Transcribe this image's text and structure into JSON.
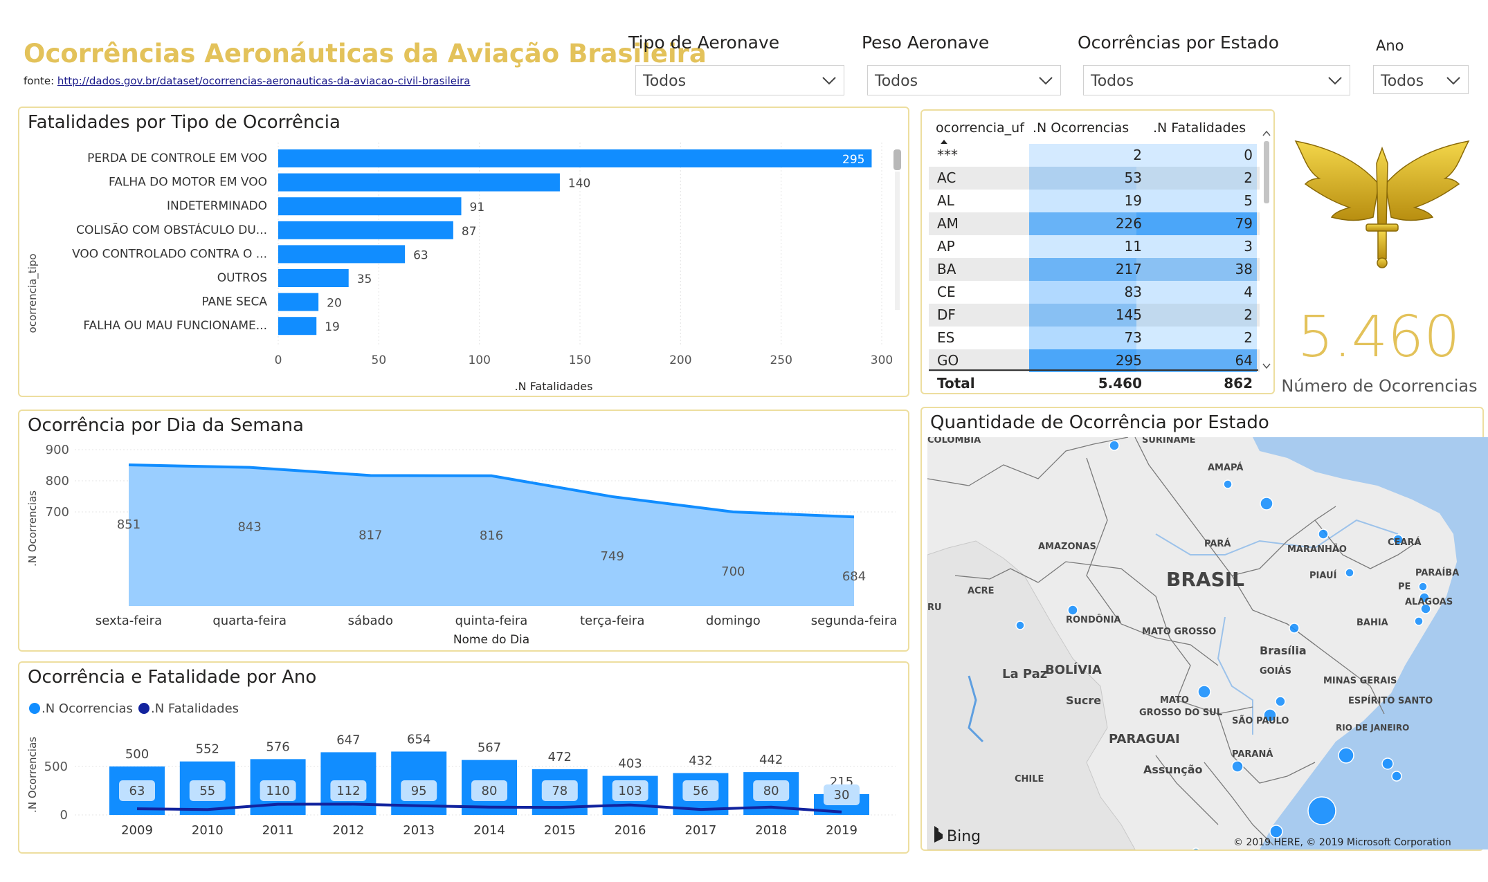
{
  "header": {
    "title": "Ocorrências Aeronáuticas da Aviação Brasileira",
    "source_prefix": "fonte: ",
    "source_link": "http://dados.gov.br/dataset/ocorrencias-aeronauticas-da-aviacao-civil-brasileira"
  },
  "filters": [
    {
      "label": "Tipo de Aeronave",
      "value": "Todos"
    },
    {
      "label": "Peso Aeronave",
      "value": "Todos"
    },
    {
      "label": "Ocorrências por Estado",
      "value": "Todos"
    },
    {
      "label": "Ano",
      "value": "Todos"
    }
  ],
  "colors": {
    "accent_gold": "#E3C25A",
    "bar_blue": "#118DFF",
    "area_blue": "#9ACEFF",
    "line_navy": "#12239E",
    "panel_border": "#EDDE9F"
  },
  "fatalities_panel": {
    "title": "Fatalidades por Tipo de Ocorrência"
  },
  "weekday_panel": {
    "title": "Ocorrência por Dia da Semana"
  },
  "year_panel": {
    "title": "Ocorrência e Fatalidade por Ano"
  },
  "state_table": {
    "headers": [
      "ocorrencia_uf",
      ".N Ocorrencias",
      ".N Fatalidades"
    ],
    "rows": [
      {
        "uf": "***",
        "ocorrencias": "2",
        "fatalidades": "0"
      },
      {
        "uf": "AC",
        "ocorrencias": "53",
        "fatalidades": "2"
      },
      {
        "uf": "AL",
        "ocorrencias": "19",
        "fatalidades": "5"
      },
      {
        "uf": "AM",
        "ocorrencias": "226",
        "fatalidades": "79"
      },
      {
        "uf": "AP",
        "ocorrencias": "11",
        "fatalidades": "3"
      },
      {
        "uf": "BA",
        "ocorrencias": "217",
        "fatalidades": "38"
      },
      {
        "uf": "CE",
        "ocorrencias": "83",
        "fatalidades": "4"
      },
      {
        "uf": "DF",
        "ocorrencias": "145",
        "fatalidades": "2"
      },
      {
        "uf": "ES",
        "ocorrencias": "73",
        "fatalidades": "2"
      },
      {
        "uf": "GO",
        "ocorrencias": "295",
        "fatalidades": "64"
      }
    ],
    "total": {
      "label": "Total",
      "ocorrencias": "5.460",
      "fatalidades": "862"
    }
  },
  "kpi": {
    "value": "5.460",
    "label": "Número de Ocorrencias"
  },
  "map_panel": {
    "title": "Quantidade de Ocorrência por Estado",
    "labels": [
      "COLOMBIA",
      "SURINAME",
      "AMAPÁ",
      "AMAZONAS",
      "PARÁ",
      "MARANHÃO",
      "CEARÁ",
      "PARAÍBA",
      "PE",
      "ALAGOAS",
      "PIAUÍ",
      "BRASIL",
      "ACRE",
      "RU",
      "RONDÔNIA",
      "MATO GROSSO",
      "BAHIA",
      "Brasília",
      "GOIÁS",
      "MINAS GERAIS",
      "La Paz",
      "BOLÍVIA",
      "Sucre",
      "MATO GROSSO DO SUL",
      "SÃO PAULO",
      "ESPÍRITO SANTO",
      "RIO DE JANEIRO",
      "PARAGUAI",
      "PARANÁ",
      "Assunção",
      "CHILE"
    ],
    "bing_label": "Bing",
    "copyright": "© 2019 HERE, © 2019 Microsoft Corporation"
  },
  "chart_data": [
    {
      "type": "bar",
      "orientation": "horizontal",
      "title": "Fatalidades por Tipo de Ocorrência",
      "ylabel": "ocorrencia_tipo",
      "xlabel": ".N Fatalidades",
      "categories": [
        "PERDA DE CONTROLE EM VOO",
        "FALHA DO MOTOR EM VOO",
        "INDETERMINADO",
        "COLISÃO COM OBSTÁCULO DU...",
        "VOO CONTROLADO CONTRA O ...",
        "OUTROS",
        "PANE SECA",
        "FALHA OU MAU FUNCIONAME..."
      ],
      "values": [
        295,
        140,
        91,
        87,
        63,
        35,
        20,
        19
      ],
      "xlim": [
        0,
        300
      ],
      "xticks": [
        0,
        50,
        100,
        150,
        200,
        250,
        300
      ]
    },
    {
      "type": "area",
      "title": "Ocorrência por Dia da Semana",
      "xlabel": "Nome do Dia",
      "ylabel": ".N Ocorrencias",
      "categories": [
        "sexta-feira",
        "quarta-feira",
        "sábado",
        "quinta-feira",
        "terça-feira",
        "domingo",
        "segunda-feira"
      ],
      "values": [
        851,
        843,
        817,
        816,
        749,
        700,
        684
      ],
      "ylim": [
        650,
        900
      ],
      "yticks": [
        700,
        800,
        900
      ]
    },
    {
      "type": "bar",
      "title": "Ocorrência e Fatalidade por Ano",
      "ylabel": ".N Ocorrencias",
      "categories": [
        "2009",
        "2010",
        "2011",
        "2012",
        "2013",
        "2014",
        "2015",
        "2016",
        "2017",
        "2018",
        "2019"
      ],
      "series": [
        {
          "name": ".N Ocorrencias",
          "kind": "bar",
          "values": [
            500,
            552,
            576,
            647,
            654,
            567,
            472,
            403,
            432,
            442,
            215
          ]
        },
        {
          "name": ".N Fatalidades",
          "kind": "line",
          "values": [
            63,
            55,
            110,
            112,
            95,
            80,
            78,
            103,
            56,
            80,
            30
          ]
        }
      ],
      "ylim": [
        0,
        650
      ],
      "yticks": [
        0,
        500
      ],
      "legend": "top-left"
    }
  ]
}
